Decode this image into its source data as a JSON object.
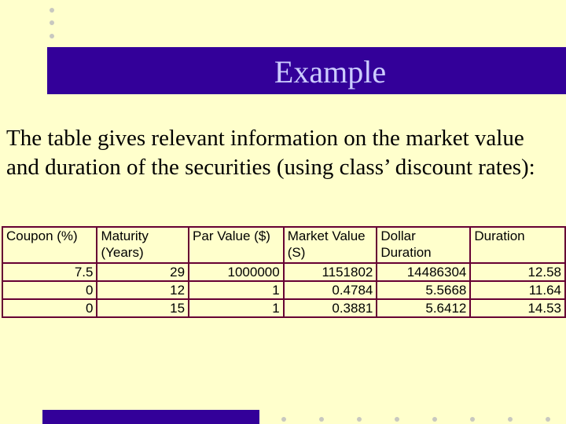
{
  "slide": {
    "title": "Example",
    "body": "The table gives relevant information on the market value and duration of the securities (using class’ discount rates):"
  },
  "table": {
    "headers": [
      "Coupon (%)",
      "Maturity (Years)",
      "Par Value ($)",
      "Market Value (S)",
      "Dollar Duration",
      "Duration"
    ],
    "rows": [
      [
        "7.5",
        "29",
        "1000000",
        "1151802",
        "14486304",
        "12.58"
      ],
      [
        "0",
        "12",
        "1",
        "0.4784",
        "5.5668",
        "11.64"
      ],
      [
        "0",
        "15",
        "1",
        "0.3881",
        "5.6412",
        "14.53"
      ]
    ]
  },
  "colors": {
    "background": "#ffffcc",
    "accent": "#330099",
    "title_text": "#ccccff",
    "table_border": "#660033"
  }
}
